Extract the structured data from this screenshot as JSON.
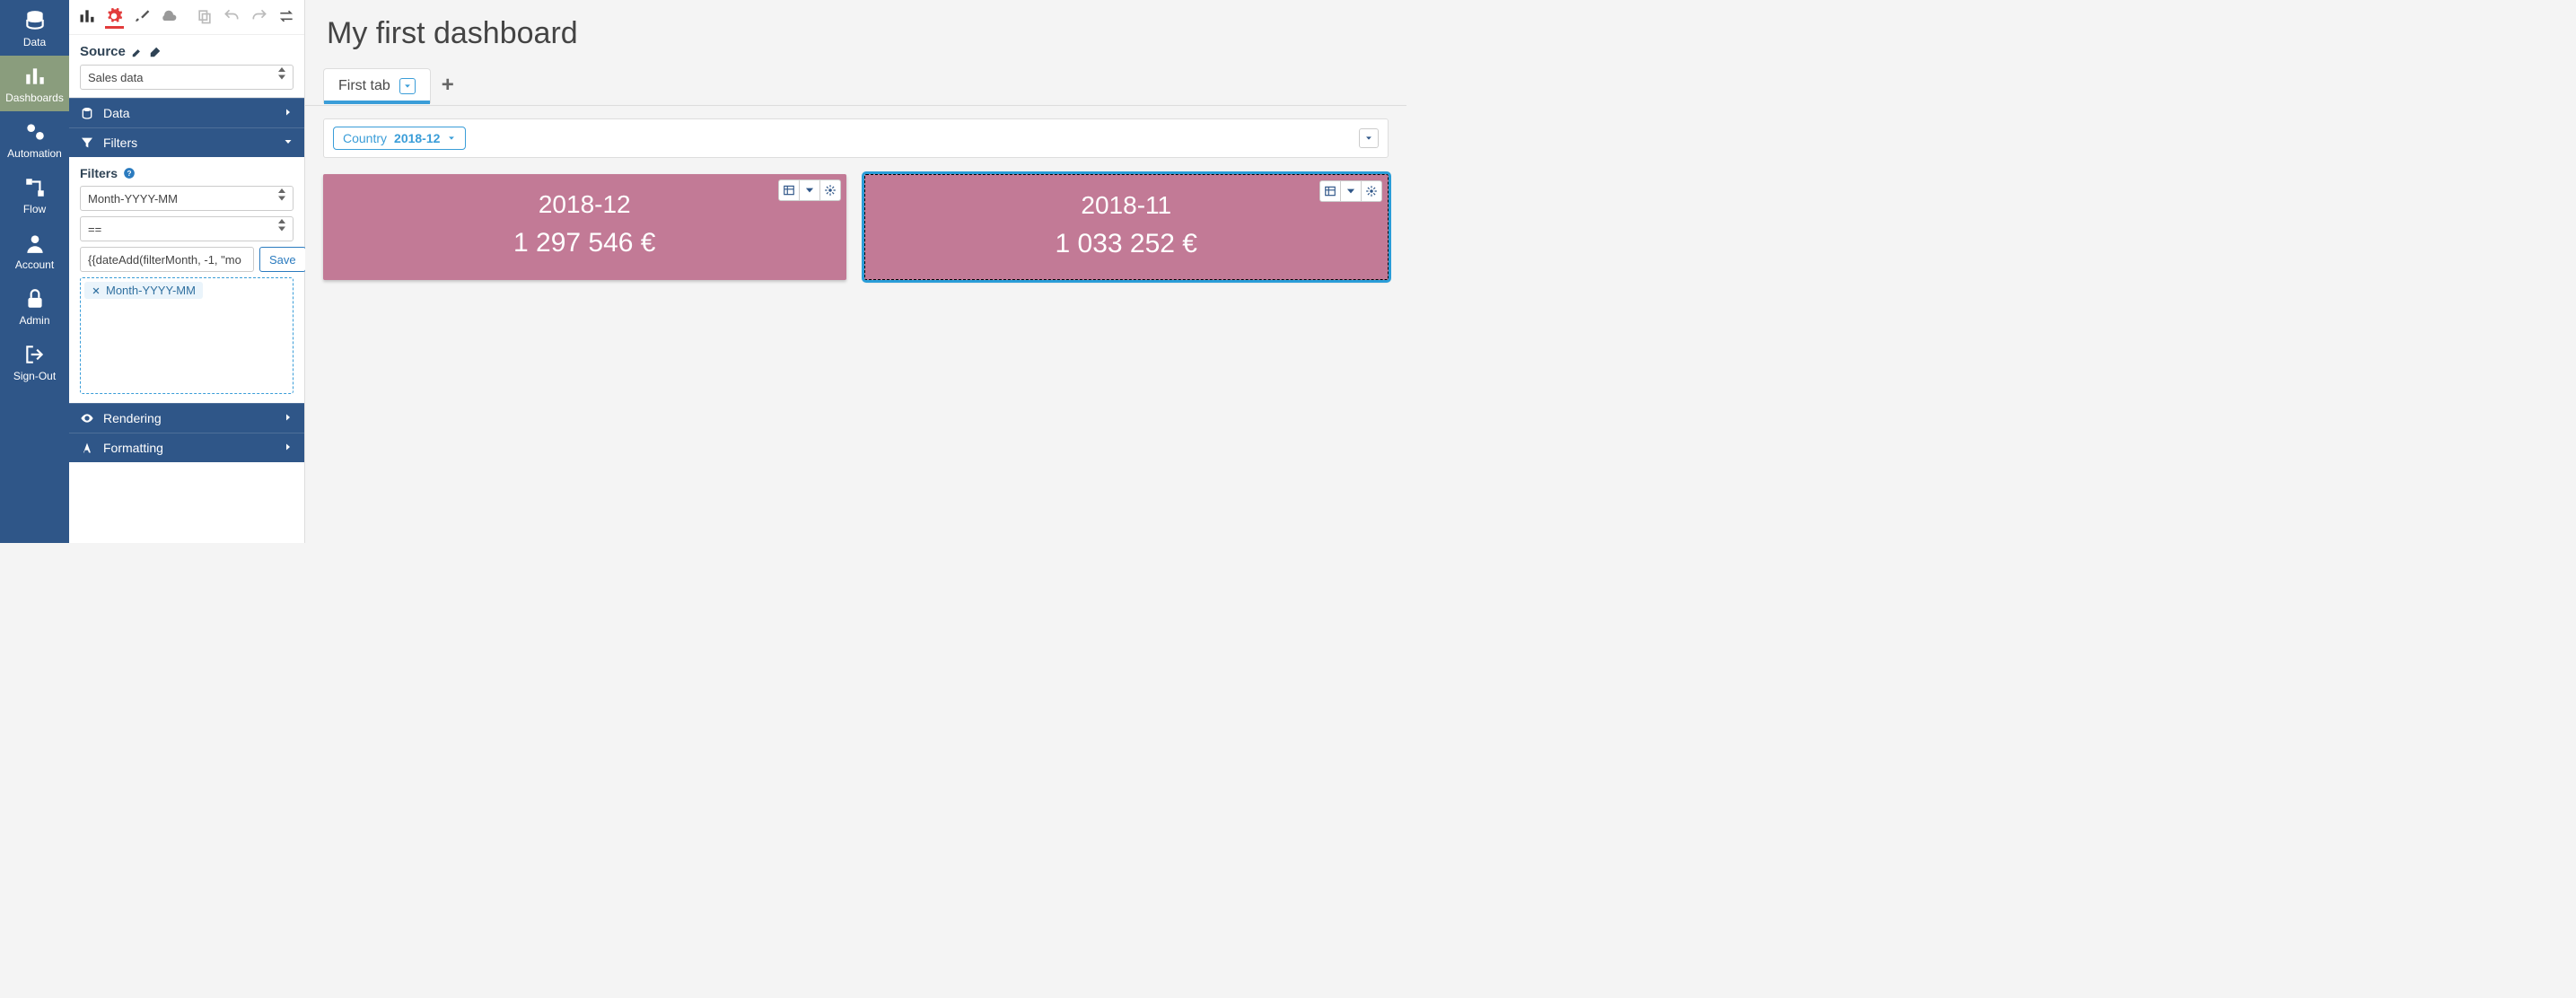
{
  "leftnav": {
    "items": [
      {
        "label": "Data"
      },
      {
        "label": "Dashboards"
      },
      {
        "label": "Automation"
      },
      {
        "label": "Flow"
      },
      {
        "label": "Account"
      },
      {
        "label": "Admin"
      },
      {
        "label": "Sign-Out"
      }
    ]
  },
  "sidepanel": {
    "source_label": "Source",
    "source_value": "Sales data",
    "accordion": {
      "data": "Data",
      "filters": "Filters",
      "rendering": "Rendering",
      "formatting": "Formatting"
    },
    "filters_section": {
      "heading": "Filters",
      "field_select": "Month-YYYY-MM",
      "operator_select": "==",
      "value_input": "{{dateAdd(filterMonth, -1, \"mo",
      "save_label": "Save",
      "chip_label": "Month-YYYY-MM"
    }
  },
  "dashboard": {
    "title": "My first dashboard",
    "tabs": [
      {
        "label": "First tab"
      }
    ],
    "filterbar": {
      "filter_label": "Country",
      "filter_value": "2018-12"
    },
    "cards": [
      {
        "title": "2018-12",
        "value": "1 297 546 €"
      },
      {
        "title": "2018-11",
        "value": "1 033 252 €"
      }
    ]
  }
}
